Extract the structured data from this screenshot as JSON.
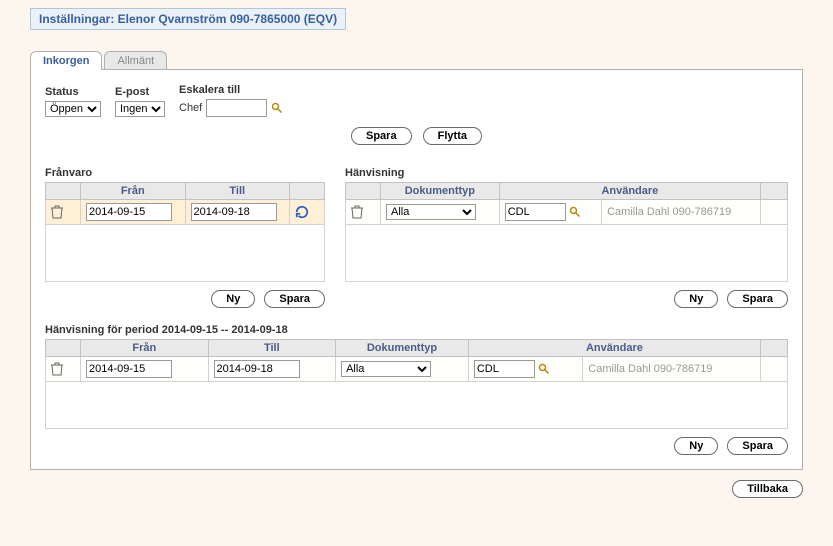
{
  "title": "Inställningar: Elenor Qvarnström 090-7865000 (EQV)",
  "tabs": {
    "inkorgen": "Inkorgen",
    "allmant": "Allmänt"
  },
  "filters": {
    "status_label": "Status",
    "status_value": "Öppen",
    "epost_label": "E-post",
    "epost_value": "Ingen",
    "eskalera_label": "Eskalera till",
    "chef_label": "Chef",
    "chef_value": ""
  },
  "buttons": {
    "spara": "Spara",
    "flytta": "Flytta",
    "ny": "Ny",
    "tillbaka": "Tillbaka"
  },
  "franvaro": {
    "title": "Frånvaro",
    "col_from": "Från",
    "col_to": "Till",
    "row": {
      "from": "2014-09-15",
      "to": "2014-09-18"
    }
  },
  "hanvisning": {
    "title": "Hänvisning",
    "col_doktyp": "Dokumenttyp",
    "col_user": "Användare",
    "row": {
      "doktyp": "Alla",
      "user_code": "CDL",
      "user_name": "Camilla Dahl 090-786719"
    }
  },
  "period": {
    "title": "Hänvisning för period 2014-09-15 -- 2014-09-18",
    "col_from": "Från",
    "col_to": "Till",
    "col_doktyp": "Dokumenttyp",
    "col_user": "Användare",
    "row": {
      "from": "2014-09-15",
      "to": "2014-09-18",
      "doktyp": "Alla",
      "user_code": "CDL",
      "user_name": "Camilla Dahl 090-786719"
    }
  }
}
